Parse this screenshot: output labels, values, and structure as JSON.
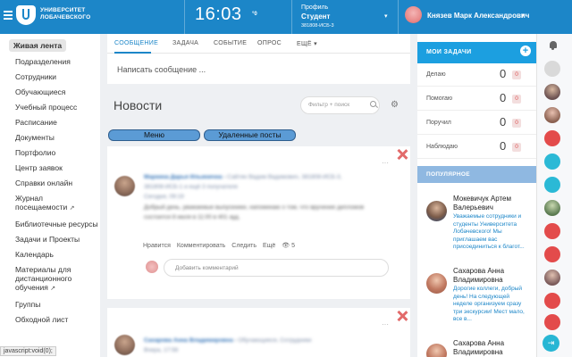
{
  "header": {
    "logo_line1": "УНИВЕРСИТЕТ",
    "logo_line2": "ЛОБАЧЕВСКОГО",
    "time": "16:03",
    "weather": "°0",
    "profile_label": "Профиль",
    "profile_role": "Студент",
    "profile_group": "381808-ИСБ-3",
    "user_name": "Князев Марк Александрович",
    "caret": "▾"
  },
  "sidebar": {
    "items": [
      {
        "label": "Живая лента",
        "active": true
      },
      {
        "label": "Подразделения"
      },
      {
        "label": "Сотрудники"
      },
      {
        "label": "Обучающиеся"
      },
      {
        "label": "Учебный процесс"
      },
      {
        "label": "Расписание"
      },
      {
        "label": "Документы"
      },
      {
        "label": "Портфолио"
      },
      {
        "label": "Центр заявок"
      },
      {
        "label": "Справки онлайн"
      },
      {
        "label": "Журнал",
        "label2": "посещаемости",
        "external": true
      },
      {
        "label": "Библиотечные ресурсы"
      },
      {
        "label": "Задачи и Проекты"
      },
      {
        "label": "Календарь"
      },
      {
        "label": "Материалы для",
        "label2": "дистанционного",
        "label3": "обучения",
        "external": true
      },
      {
        "label": "Группы"
      },
      {
        "label": "Обходной лист"
      }
    ],
    "external_icon": "↗"
  },
  "status_bar": "javascript:void(0);",
  "composer": {
    "tabs": [
      "СООБЩЕНИЕ",
      "ЗАДАЧА",
      "СОБЫТИЕ",
      "ОПРОС",
      "ЕЩЁ"
    ],
    "more_caret": "▾",
    "placeholder": "Написать сообщение ..."
  },
  "news": {
    "title": "Новости",
    "filter_placeholder": "Фильтр + поиск",
    "menu_button": "Меню",
    "deleted_button": "Удаленные посты",
    "gear_icon": "⚙"
  },
  "posts": [
    {
      "author": "Маркина Дарья Ильинична",
      "header_rest": "Сайтян Вадим Вадимович, 381808-ИСБ-3,",
      "line2": "381808-ИСБ-1 и ещё 3 получателя",
      "date": "Сегодня, 09:19",
      "body1": "Добрый день, уважаемые выпускники, напоминаю о том, что вручение дипломов",
      "body2": "состоится 8 июля в 11:00 в 401 ауд."
    },
    {
      "author": "Сахарова Анна Владимировна",
      "header_rest": "Обучающиеся, Сотрудники",
      "line2": "Вчера, 17:58"
    }
  ],
  "post_actions": {
    "like": "Нравится",
    "comment": "Комментировать",
    "share": "Следить",
    "more": "Ещё",
    "views": "👁 5",
    "comment_placeholder": "Добавить комментарий",
    "dots": "···"
  },
  "tasks": {
    "title": "МОИ ЗАДАЧИ",
    "add": "+",
    "rows": [
      {
        "label": "Делаю",
        "count": "0",
        "badge": "0"
      },
      {
        "label": "Помогаю",
        "count": "0",
        "badge": "0"
      },
      {
        "label": "Поручил",
        "count": "0",
        "badge": "0"
      },
      {
        "label": "Наблюдаю",
        "count": "0",
        "badge": "0"
      }
    ]
  },
  "popular": {
    "title": "ПОПУЛЯРНОЕ",
    "items": [
      {
        "name1": "Мокевичук Артем",
        "name2": "Валерьевич",
        "text": [
          "Уважаемые сотрудники и",
          "студенты Университета",
          "Лобачевского! Мы",
          "приглашаем вас",
          "присоединиться к благот..."
        ]
      },
      {
        "name1": "Сахарова Анна",
        "name2": "Владимировна",
        "text": [
          "Дорогие коллеги, добрый",
          "день! На следующей",
          "неделе организуем сразу",
          "три экскурсии! Мест мало,",
          "все в..."
        ]
      },
      {
        "name1": "Сахарова Анна",
        "name2": "Владимировна",
        "text": []
      }
    ]
  },
  "strip": {
    "exit_icon": "⇥"
  },
  "colors": {
    "header": "#1c86c8",
    "tasks_header": "#1c9fe0",
    "popular_header": "#8fb8e1",
    "pill_button": "#5b9bd5"
  }
}
